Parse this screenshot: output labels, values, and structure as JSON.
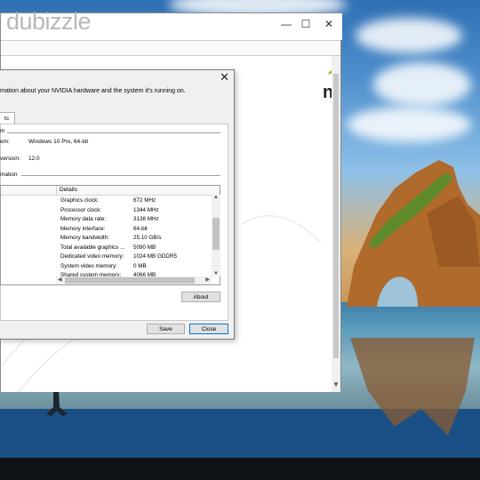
{
  "browser": {
    "logo_text": "dubizzle",
    "minimize_glyph": "—",
    "maximize_glyph": "☐",
    "close_glyph": "✕",
    "page_mark": "n",
    "accent_color": "#76b900"
  },
  "dialog": {
    "description": "mation about your NVIDIA hardware and the system it's running on.",
    "close_glyph": "✕",
    "tab_label": "ts",
    "system_group_label": "m",
    "os_label": "em:",
    "os_value": "Windows 10 Pro, 64-bit",
    "directx_label": "version:",
    "directx_value": "12.0",
    "info_group_label": "mation",
    "list": {
      "details_header": "Details",
      "rows": [
        {
          "label": "Graphics clock:",
          "value": "672 MHz"
        },
        {
          "label": "Processor clock:",
          "value": "1344 MHz"
        },
        {
          "label": "Memory data rate:",
          "value": "3138 MHz"
        },
        {
          "label": "Memory interface:",
          "value": "64-bit"
        },
        {
          "label": "Memory bandwidth:",
          "value": "25.10 GB/s"
        },
        {
          "label": "Total available graphics ...",
          "value": "5090 MB"
        },
        {
          "label": "Dedicated video memory:",
          "value": "1024 MB GDDR5"
        },
        {
          "label": "System video memory:",
          "value": "0 MB"
        },
        {
          "label": "Shared system memory:",
          "value": "4066 MB"
        }
      ]
    },
    "about_button": "About",
    "save_button": "Save",
    "close_button": "Close"
  }
}
